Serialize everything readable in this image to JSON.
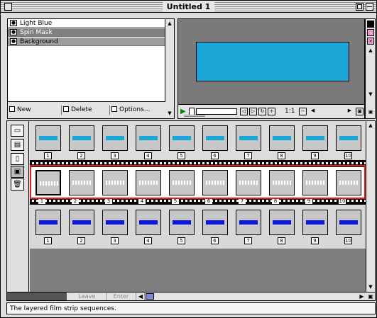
{
  "window": {
    "title": "Untitled 1"
  },
  "layers": {
    "items": [
      {
        "name": "Light Blue",
        "selected": false
      },
      {
        "name": "Spin Mask",
        "selected": true
      },
      {
        "name": "Background",
        "selected": true
      }
    ],
    "buttons": {
      "new": "New",
      "delete": "Delete",
      "options": "Options..."
    }
  },
  "preview": {
    "zoom": "1:1",
    "rect_color": "#1aa7d8",
    "progress_fraction": 0.0
  },
  "filmstrip": {
    "frame_count": 10,
    "numbers": [
      "1",
      "2",
      "3",
      "4",
      "5",
      "6",
      "7",
      "8",
      "9",
      "10"
    ],
    "colors": {
      "light_blue": "#1aa7d8",
      "blue": "#0b16e0",
      "mask_highlight": "#e02020"
    }
  },
  "bottom_bar": {
    "leave": "Leave",
    "enter": "Enter"
  },
  "status": {
    "text": "The layered film strip sequences."
  }
}
